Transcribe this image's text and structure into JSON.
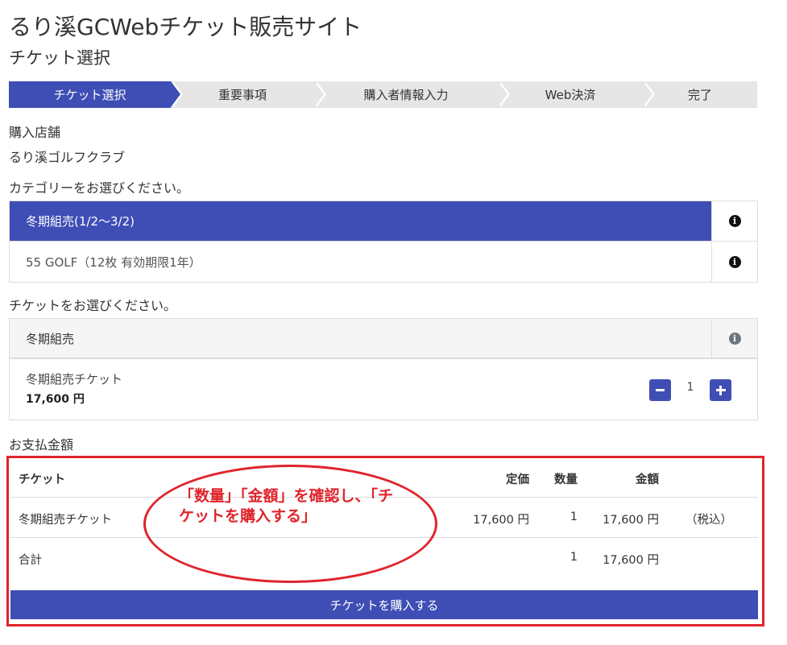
{
  "header": {
    "site_title": "るり溪GCWebチケット販売サイト",
    "page_title": "チケット選択"
  },
  "steps": [
    {
      "label": "チケット選択",
      "active": true
    },
    {
      "label": "重要事項",
      "active": false
    },
    {
      "label": "購入者情報入力",
      "active": false
    },
    {
      "label": "Web決済",
      "active": false
    },
    {
      "label": "完了",
      "active": false
    }
  ],
  "store": {
    "label": "購入店舗",
    "name": "るり溪ゴルフクラブ"
  },
  "category": {
    "prompt": "カテゴリーをお選びください。",
    "items": [
      {
        "name": "冬期組売(1/2〜3/2)",
        "selected": true
      },
      {
        "name": "55 GOLF（12枚 有効期限1年）",
        "selected": false
      }
    ]
  },
  "ticket": {
    "prompt": "チケットをお選びください。",
    "group_name": "冬期組売",
    "item_name": "冬期組売チケット",
    "item_price": "17,600 円",
    "quantity": "1"
  },
  "payment": {
    "label": "お支払金額",
    "headers": {
      "ticket": "チケット",
      "price": "定価",
      "qty": "数量",
      "amount": "金額"
    },
    "rows": [
      {
        "ticket": "冬期組売チケット",
        "price": "17,600 円",
        "qty": "1",
        "amount": "17,600 円",
        "tax": "（税込）"
      }
    ],
    "total": {
      "label": "合計",
      "qty": "1",
      "amount": "17,600 円"
    },
    "buy_label": "チケットを購入する"
  },
  "annotation": {
    "text": "「数量」「金額」を確認し、「チケットを購入する」"
  },
  "colors": {
    "accent": "#3f4eb5",
    "annotation_red": "#e0242c"
  }
}
